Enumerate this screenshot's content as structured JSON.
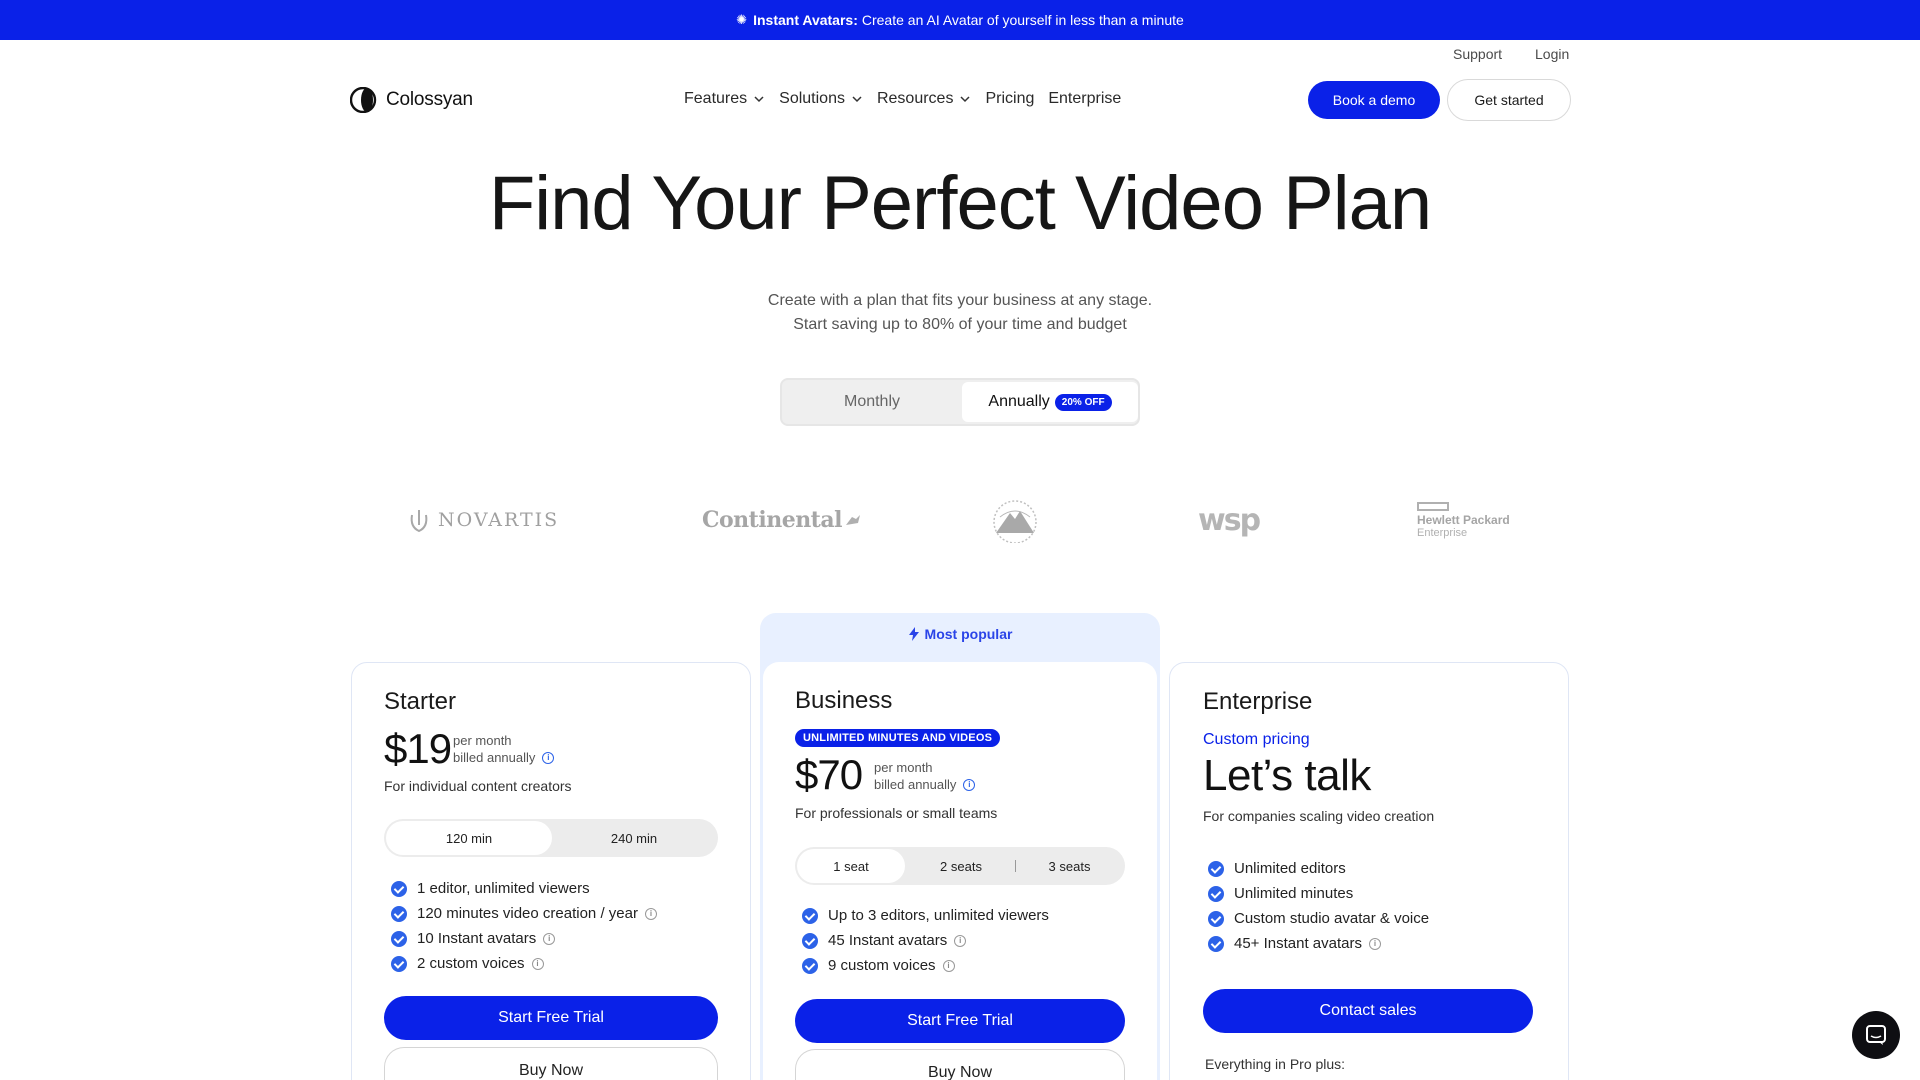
{
  "announcement": {
    "title": "Instant Avatars:",
    "text": "Create an AI Avatar of yourself in less than a minute"
  },
  "utility_nav": {
    "support": "Support",
    "login": "Login"
  },
  "brand": {
    "name": "Colossyan",
    "accent": "#0a21e8"
  },
  "nav": {
    "items": [
      {
        "label": "Features",
        "dropdown": true
      },
      {
        "label": "Solutions",
        "dropdown": true
      },
      {
        "label": "Resources",
        "dropdown": true
      },
      {
        "label": "Pricing",
        "dropdown": false
      },
      {
        "label": "Enterprise",
        "dropdown": false
      }
    ],
    "book_demo": "Book a demo",
    "get_started": "Get started"
  },
  "hero": {
    "title": "Find Your Perfect Video Plan",
    "subtitle_line1": "Create with a plan that fits your business at any stage.",
    "subtitle_line2": "Start saving up to 80% of your time and budget"
  },
  "billing": {
    "monthly": "Monthly",
    "annually": "Annually",
    "discount": "20% OFF",
    "selected": "annually"
  },
  "clients": {
    "novartis": "NOVARTIS",
    "continental": "Continental",
    "wsp": "wsp",
    "hpe_line1": "Hewlett Packard",
    "hpe_line2": "Enterprise"
  },
  "plans": {
    "starter": {
      "name": "Starter",
      "price": "$19",
      "price_note1": "per month",
      "price_note2": "billed annually",
      "description": "For individual content creators",
      "options": [
        "120 min",
        "240 min"
      ],
      "features": [
        "1 editor, unlimited viewers",
        "120 minutes video creation / year",
        "10 Instant avatars",
        "2 custom voices"
      ],
      "cta_primary": "Start Free Trial",
      "cta_secondary": "Buy Now"
    },
    "business": {
      "popular": "Most popular",
      "name": "Business",
      "badge": "UNLIMITED MINUTES AND VIDEOS",
      "price": "$70",
      "price_note1": "per month",
      "price_note2": "billed annually",
      "description": "For professionals or small teams",
      "options": [
        "1 seat",
        "2 seats",
        "3 seats"
      ],
      "features": [
        "Up to 3 editors, unlimited viewers",
        "45 Instant avatars",
        "9 custom voices"
      ],
      "cta_primary": "Start Free Trial",
      "cta_secondary": "Buy Now"
    },
    "enterprise": {
      "name": "Enterprise",
      "custom_pricing": "Custom pricing",
      "headline": "Let’s talk",
      "description": "For companies scaling video creation",
      "features": [
        "Unlimited editors",
        "Unlimited minutes",
        "Custom studio avatar & voice",
        "45+ Instant avatars"
      ],
      "cta_primary": "Contact sales",
      "everything_plus": "Everything in Pro plus:"
    }
  }
}
